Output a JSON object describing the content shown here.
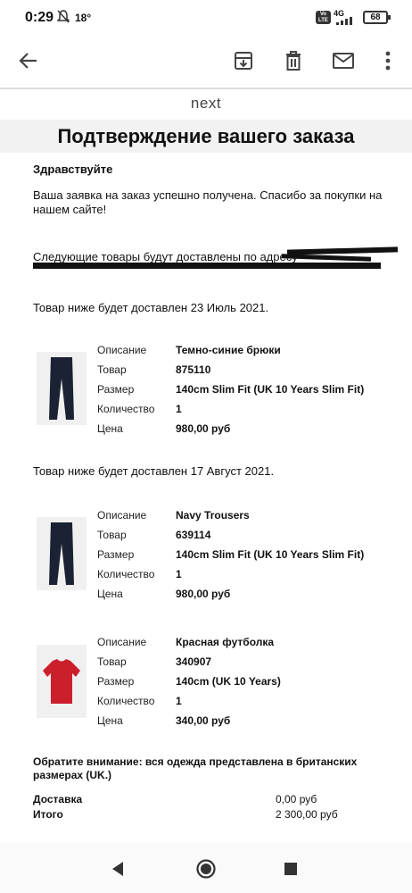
{
  "status_bar": {
    "time": "0:29",
    "temperature": "18°",
    "network": "4G",
    "volte": "Vo LTE",
    "battery": "68"
  },
  "toolbar": {
    "back": "back-arrow",
    "archive": "archive-icon",
    "delete": "trash-icon",
    "mail": "mail-icon",
    "more": "more-vert-icon"
  },
  "email": {
    "brand": "next",
    "title": "Подтверждение вашего заказа",
    "greeting": "Здравствуйте",
    "received_line1": "Ваша заявка на заказ успешно получена. Спасибо за покупки на",
    "received_line2": "нашем сайте!",
    "delivery_address_prefix": "Следующие товары будут доставлены по адресу",
    "shipments": [
      {
        "date_text": "Товар ниже будет доставлен 23 Июль 2021.",
        "items": [
          {
            "image": "navy-trousers",
            "description": "Темно-синие брюки",
            "item_no": "875110",
            "size": "140cm Slim Fit (UK 10 Years Slim Fit)",
            "qty": "1",
            "price": "980,00 руб"
          }
        ]
      },
      {
        "date_text": "Товар ниже будет доставлен 17 Август 2021.",
        "items": [
          {
            "image": "navy-trousers",
            "description": "Navy Trousers",
            "item_no": "639114",
            "size": "140cm Slim Fit (UK 10 Years Slim Fit)",
            "qty": "1",
            "price": "980,00 руб"
          },
          {
            "image": "red-t-shirt",
            "description": "Красная футболка",
            "item_no": "340907",
            "size": "140cm (UK 10 Years)",
            "qty": "1",
            "price": "340,00 руб"
          }
        ]
      }
    ],
    "labels": {
      "description": "Описание",
      "item": "Товар",
      "size": "Размер",
      "quantity": "Количество",
      "price": "Цена"
    },
    "note_line1": "Обратите внимание: вся одежда представлена в британских",
    "note_line2": "размерах (UK.)",
    "totals": {
      "delivery_label": "Доставка",
      "delivery_value": "0,00 руб",
      "total_label": "Итого",
      "total_value": "2 300,00 руб"
    }
  },
  "nav": {
    "back": "nav-back-icon",
    "home": "nav-home-icon",
    "recents": "nav-recents-icon"
  }
}
